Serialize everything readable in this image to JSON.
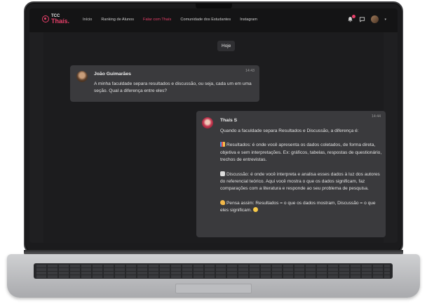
{
  "app": {
    "logo_line1": "TCC",
    "logo_line2": "Thaís."
  },
  "nav": {
    "items": [
      {
        "label": "Início",
        "active": false
      },
      {
        "label": "Ranking de Alunos",
        "active": false
      },
      {
        "label": "Falar com Thaís",
        "active": true
      },
      {
        "label": "Comunidade dos Estudantes",
        "active": false
      },
      {
        "label": "Instagram",
        "active": false
      }
    ]
  },
  "header_icons": [
    "notifications-icon",
    "messages-icon",
    "user-avatar",
    "chevron-down-icon"
  ],
  "chat": {
    "date_label": "Hoje",
    "messages": [
      {
        "author": "João Guimarães",
        "time": "14:43",
        "text": "A minha faculdade separa resultados e discussão, ou seja, cada um em uma seção. Qual a diferença entre eles?"
      },
      {
        "author": "Thaís S",
        "time": "14:44",
        "paragraphs": [
          "Quando a faculdade separa Resultados e Discussão, a diferença é:",
          "Resultados: é onde você apresenta os dados coletados, de forma direta, objetiva e sem interpretações. Ex: gráficos, tabelas, respostas de questionário, trechos de entrevistas.",
          "Discussão: é onde você interpreta e analisa esses dados à luz dos autores do referencial teórico. Aqui você mostra o que os dados significam, faz comparações com a literatura e responde ao seu problema de pesquisa.",
          "Pensa assim: Resultados = o que os dados mostram, Discussão = o que eles significam."
        ]
      }
    ]
  },
  "colors": {
    "accent": "#e8406a",
    "background": "#1c1c1e",
    "bubble": "#3a3a3d"
  }
}
